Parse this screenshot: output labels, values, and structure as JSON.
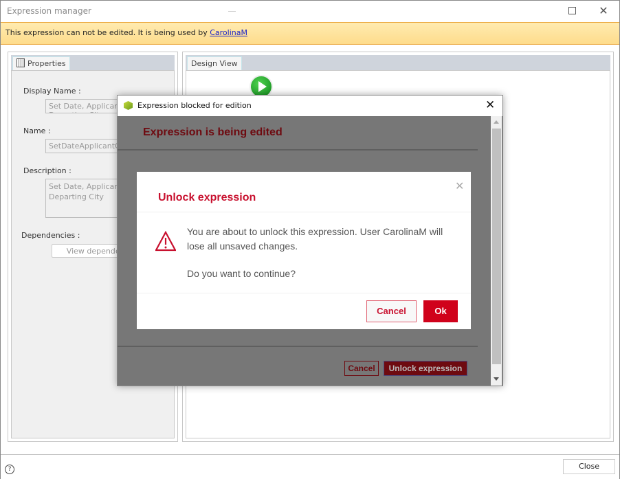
{
  "window": {
    "title": "Expression manager",
    "controls": {
      "minimize": "minimize",
      "maximize": "maximize",
      "close": "close"
    }
  },
  "banner": {
    "message": "This expression can not be edited. It is being used by ",
    "user": "CarolinaM",
    "color": "#fedc8c"
  },
  "properties_panel": {
    "tab_label": "Properties",
    "tab_icon": "grid-sheet-icon",
    "display_name_label": "Display Name :",
    "display_name_value": "Set Date, Applicant and Departing City",
    "name_label": "Name :",
    "name_value": "SetDateApplicantCity",
    "description_label": "Description :",
    "description_value": "Set Date, Applicant and Departing City",
    "dependencies_label": "Dependencies :",
    "view_dependencies_button": "View dependencies"
  },
  "design_panel": {
    "tab_label": "Design View",
    "start_icon": "play-icon"
  },
  "footer": {
    "help_icon": "?",
    "close_button": "Close"
  },
  "blocked_dialog": {
    "title": "Expression blocked for edition",
    "heading": "Expression is being edited",
    "cancel_button": "Cancel",
    "unlock_button": "Unlock expression",
    "close_glyph": "✕"
  },
  "unlock_modal": {
    "heading": "Unlock expression",
    "message": "You are about to unlock this expression. User CarolinaM will lose all unsaved changes.",
    "question": "Do you want to continue?",
    "cancel_button": "Cancel",
    "ok_button": "Ok",
    "close_glyph": "✕",
    "accent_color": "#d0021b"
  }
}
